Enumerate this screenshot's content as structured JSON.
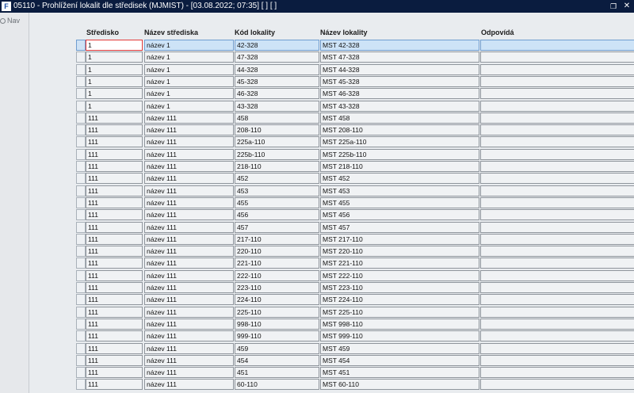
{
  "window": {
    "app_icon": "F",
    "title": "05110 - Prohlížení lokalit dle středisek (MJMIST) - [03.08.2022; 07:35]  [ ]  [ ]",
    "restore_icon": "restore-icon",
    "close_icon": "close-icon"
  },
  "nav": {
    "label": "Nav"
  },
  "table": {
    "headers": [
      "Středisko",
      "Název střediska",
      "Kód lokality",
      "Název lokality",
      "Odpovídá"
    ],
    "rows": [
      [
        "1",
        "název 1",
        "42-328",
        "MST 42-328",
        ""
      ],
      [
        "1",
        "název 1",
        "47-328",
        "MST 47-328",
        ""
      ],
      [
        "1",
        "název 1",
        "44-328",
        "MST 44-328",
        ""
      ],
      [
        "1",
        "název 1",
        "45-328",
        "MST 45-328",
        ""
      ],
      [
        "1",
        "název 1",
        "46-328",
        "MST 46-328",
        ""
      ],
      [
        "1",
        "název 1",
        "43-328",
        "MST 43-328",
        ""
      ],
      [
        "111",
        "název 111",
        "458",
        "MST 458",
        ""
      ],
      [
        "111",
        "název 111",
        "208-110",
        "MST 208-110",
        ""
      ],
      [
        "111",
        "název 111",
        "225a-110",
        "MST 225a-110",
        ""
      ],
      [
        "111",
        "název 111",
        "225b-110",
        "MST 225b-110",
        ""
      ],
      [
        "111",
        "název 111",
        "218-110",
        "MST 218-110",
        ""
      ],
      [
        "111",
        "název 111",
        "452",
        "MST 452",
        ""
      ],
      [
        "111",
        "název 111",
        "453",
        "MST 453",
        ""
      ],
      [
        "111",
        "název 111",
        "455",
        "MST 455",
        ""
      ],
      [
        "111",
        "název 111",
        "456",
        "MST 456",
        ""
      ],
      [
        "111",
        "název 111",
        "457",
        "MST 457",
        ""
      ],
      [
        "111",
        "název 111",
        "217-110",
        "MST 217-110",
        ""
      ],
      [
        "111",
        "název 111",
        "220-110",
        "MST 220-110",
        ""
      ],
      [
        "111",
        "název 111",
        "221-110",
        "MST 221-110",
        ""
      ],
      [
        "111",
        "název 111",
        "222-110",
        "MST 222-110",
        ""
      ],
      [
        "111",
        "název 111",
        "223-110",
        "MST 223-110",
        ""
      ],
      [
        "111",
        "název 111",
        "224-110",
        "MST 224-110",
        ""
      ],
      [
        "111",
        "název 111",
        "225-110",
        "MST 225-110",
        ""
      ],
      [
        "111",
        "název 111",
        "998-110",
        "MST 998-110",
        ""
      ],
      [
        "111",
        "název 111",
        "999-110",
        "MST 999-110",
        ""
      ],
      [
        "111",
        "název 111",
        "459",
        "MST 459",
        ""
      ],
      [
        "111",
        "název 111",
        "454",
        "MST 454",
        ""
      ],
      [
        "111",
        "název 111",
        "451",
        "MST 451",
        ""
      ],
      [
        "111",
        "název 111",
        "60-110",
        "MST 60-110",
        ""
      ]
    ],
    "current_row": 0
  },
  "colors": {
    "titlebar": "#0a1c3f",
    "current_row": "#cde3f7",
    "focus_border": "#e23b3b"
  }
}
